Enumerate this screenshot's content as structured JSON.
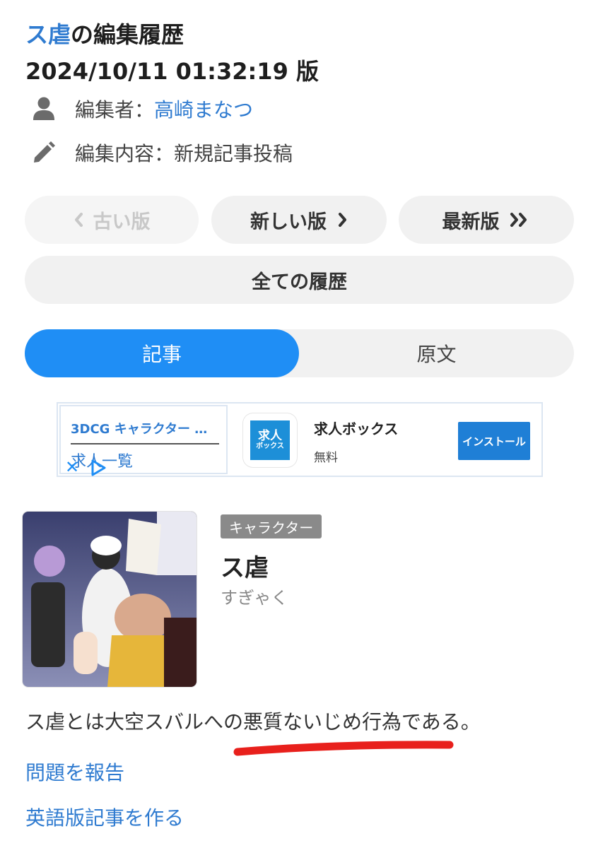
{
  "header": {
    "article_link": "ス虐",
    "title_suffix": "の編集履歴",
    "version_line": "2024/10/11 01:32:19 版"
  },
  "meta": {
    "editor_label": "編集者：",
    "editor_name": "高崎まなつ",
    "edit_content": "編集内容：新規記事投稿"
  },
  "nav": {
    "older": "古い版",
    "newer": "新しい版",
    "latest": "最新版",
    "all_history": "全ての履歴"
  },
  "tabs": {
    "article": "記事",
    "source": "原文"
  },
  "ad": {
    "title": "3DCG キャラクター …",
    "subtitle": "求人一覧",
    "app_icon_top": "求人",
    "app_icon_bottom": "ボックス",
    "app_name": "求人ボックス",
    "price": "無料",
    "install": "インストール",
    "close_symbol": "✕"
  },
  "article": {
    "badge": "キャラクター",
    "name": "ス虐",
    "reading": "すぎゃく",
    "summary": "ス虐とは大空スバルへの悪質ないじめ行為である。"
  },
  "links": {
    "report": "問題を報告",
    "english": "英語版記事を作る"
  },
  "colors": {
    "link": "#2f7bd0",
    "accent": "#1f8ef5",
    "underline_annotation": "#e8201c"
  },
  "icons": {
    "editor": "person-icon",
    "edit": "pencil-icon",
    "older": "chevron-left-icon",
    "newer": "chevron-right-icon",
    "latest": "double-chevron-right-icon"
  }
}
